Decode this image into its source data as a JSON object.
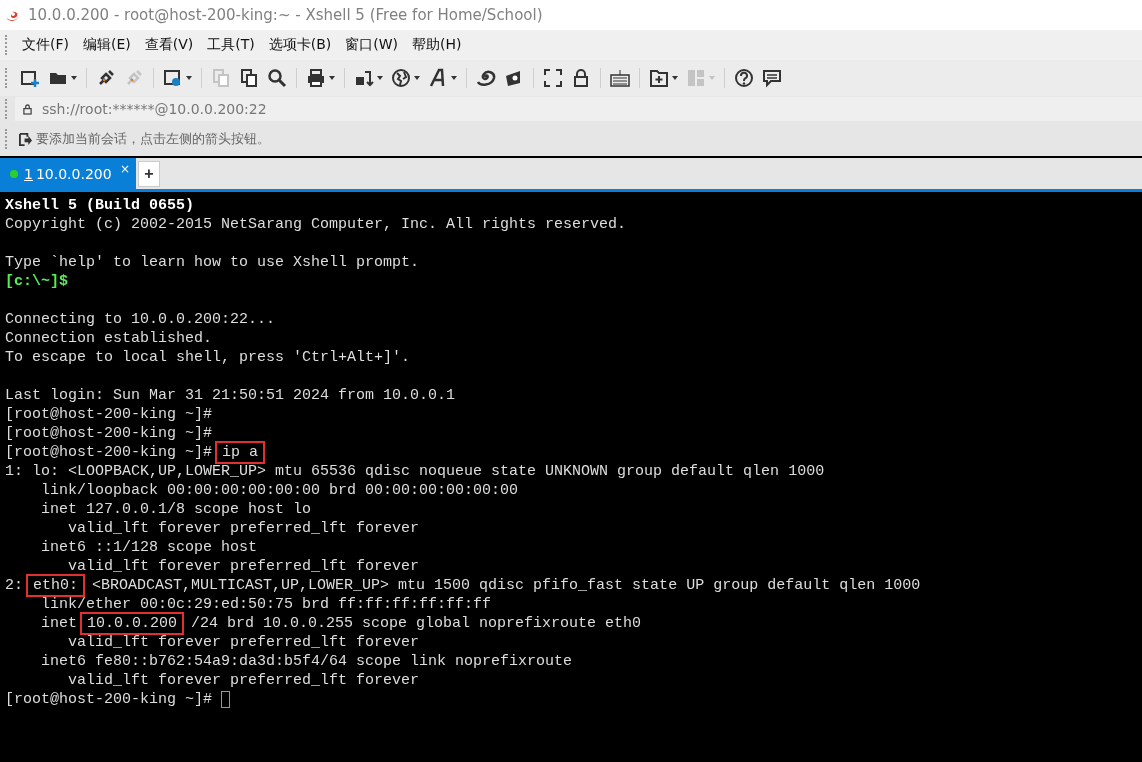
{
  "window": {
    "title": "10.0.0.200 - root@host-200-king:~ - Xshell 5 (Free for Home/School)"
  },
  "menu": [
    "文件(F)",
    "编辑(E)",
    "查看(V)",
    "工具(T)",
    "选项卡(B)",
    "窗口(W)",
    "帮助(H)"
  ],
  "toolbar": [
    [
      {
        "dropdown": false,
        "disabled": false
      },
      {
        "dropdown": true,
        "disabled": false
      }
    ],
    [
      {
        "dropdown": false,
        "disabled": false
      },
      {
        "dropdown": false,
        "disabled": true
      }
    ],
    [
      {
        "dropdown": true,
        "disabled": false
      }
    ],
    [
      {
        "dropdown": false,
        "disabled": true
      },
      {
        "dropdown": false,
        "disabled": false
      },
      {
        "dropdown": false,
        "disabled": false
      }
    ],
    [
      {
        "dropdown": true,
        "disabled": false
      }
    ],
    [
      {
        "dropdown": true,
        "disabled": false
      },
      {
        "dropdown": true,
        "disabled": false
      },
      {
        "dropdown": true,
        "disabled": false
      }
    ],
    [
      {
        "dropdown": false,
        "disabled": false
      },
      {
        "dropdown": false,
        "disabled": false
      }
    ],
    [
      {
        "dropdown": false,
        "disabled": false
      },
      {
        "dropdown": false,
        "disabled": false
      }
    ],
    [
      {
        "dropdown": false,
        "disabled": false
      }
    ],
    [
      {
        "dropdown": true,
        "disabled": false
      },
      {
        "dropdown": true,
        "disabled": true
      }
    ],
    [
      {
        "dropdown": false,
        "disabled": false
      },
      {
        "dropdown": false,
        "disabled": false
      }
    ]
  ],
  "address": {
    "value": "ssh://root:******@10.0.0.200:22"
  },
  "hint": "要添加当前会话，点击左侧的箭头按钮。",
  "tabs": [
    {
      "number": "1",
      "label": "10.0.0.200",
      "selected": true,
      "connected": true,
      "close": "×"
    }
  ],
  "new_tab": "+",
  "terminal": {
    "blocks": [
      [
        [
          {
            "kind": "bold",
            "text": "Xshell 5 (Build 0655)"
          }
        ],
        [
          {
            "kind": "plain",
            "text": "Copyright (c) 2002-2015 NetSarang Computer, Inc. All rights reserved."
          }
        ]
      ],
      [
        [
          {
            "kind": "plain",
            "text": "Type `help' to learn how to use Xshell prompt."
          }
        ],
        [
          {
            "kind": "prompt",
            "text": "[c:\\~]$"
          }
        ]
      ],
      [
        [
          {
            "kind": "plain",
            "text": "Connecting to 10.0.0.200:22..."
          }
        ],
        [
          {
            "kind": "plain",
            "text": "Connection established."
          }
        ],
        [
          {
            "kind": "plain",
            "text": "To escape to local shell, press 'Ctrl+Alt+]'."
          }
        ]
      ],
      [
        [
          {
            "kind": "plain",
            "text": "Last login: Sun Mar 31 21:50:51 2024 from 10.0.0.1"
          }
        ],
        [
          {
            "kind": "plain",
            "text": "[root@host-200-king ~]#"
          }
        ],
        [
          {
            "kind": "plain",
            "text": "[root@host-200-king ~]#"
          }
        ],
        [
          {
            "kind": "plain",
            "text": "[root@host-200-king ~]#"
          },
          {
            "kind": "boxed",
            "text": "ip a"
          }
        ],
        [
          {
            "kind": "plain",
            "text": "1: lo: <LOOPBACK,UP,LOWER_UP> mtu 65536 qdisc noqueue state UNKNOWN group default qlen 1000"
          }
        ],
        [
          {
            "kind": "plain",
            "text": "    link/loopback 00:00:00:00:00:00 brd 00:00:00:00:00:00"
          }
        ],
        [
          {
            "kind": "plain",
            "text": "    inet 127.0.0.1/8 scope host lo"
          }
        ],
        [
          {
            "kind": "plain",
            "text": "       valid_lft forever preferred_lft forever"
          }
        ],
        [
          {
            "kind": "plain",
            "text": "    inet6 ::1/128 scope host"
          }
        ],
        [
          {
            "kind": "plain",
            "text": "       valid_lft forever preferred_lft forever"
          }
        ],
        [
          {
            "kind": "plain",
            "text": "2:"
          },
          {
            "kind": "boxed",
            "text": "eth0:"
          },
          {
            "kind": "plain",
            "text": "<BROADCAST,MULTICAST,UP,LOWER_UP> mtu 1500 qdisc pfifo_fast state UP group default qlen 1000"
          }
        ],
        [
          {
            "kind": "plain",
            "text": "    link/ether 00:0c:29:ed:50:75 brd ff:ff:ff:ff:ff:ff"
          }
        ],
        [
          {
            "kind": "plain",
            "text": "    inet"
          },
          {
            "kind": "boxed",
            "text": "10.0.0.200"
          },
          {
            "kind": "plain",
            "text": "/24 brd 10.0.0.255 scope global noprefixroute eth0"
          }
        ],
        [
          {
            "kind": "plain",
            "text": "       valid_lft forever preferred_lft forever"
          }
        ],
        [
          {
            "kind": "plain",
            "text": "    inet6 fe80::b762:54a9:da3d:b5f4/64 scope link noprefixroute"
          }
        ],
        [
          {
            "kind": "plain",
            "text": "       valid_lft forever preferred_lft forever"
          }
        ],
        [
          {
            "kind": "plain",
            "text": "[root@host-200-king ~]#"
          },
          {
            "kind": "cursor"
          }
        ]
      ]
    ]
  }
}
